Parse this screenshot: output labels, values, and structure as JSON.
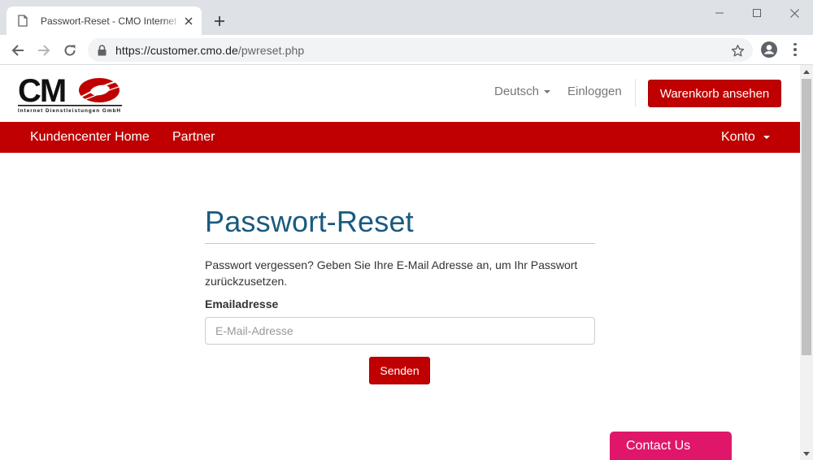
{
  "browser": {
    "tab_title": "Passwort-Reset - CMO Internet Dienstleistungen GmbH",
    "url_host": "https://customer.cmo.de",
    "url_path": "/pwreset.php"
  },
  "site": {
    "logo_letters": "CMO",
    "logo_subtitle": "Internet Dienstleistungen GmbH",
    "brand_color": "#c00000",
    "language_label": "Deutsch",
    "login_label": "Einloggen",
    "cart_button": "Warenkorb ansehen"
  },
  "nav": {
    "items": [
      {
        "label": "Kundencenter Home"
      },
      {
        "label": "Partner"
      }
    ],
    "account_label": "Konto"
  },
  "main": {
    "title": "Passwort-Reset",
    "title_color": "#1a5a80",
    "intro": "Passwort vergessen? Geben Sie Ihre E-Mail Adresse an, um Ihr Passwort zurückzusetzen.",
    "email_label": "Emailadresse",
    "email_placeholder": "E-Mail-Adresse",
    "email_value": "",
    "submit_label": "Senden"
  },
  "contact": {
    "label": "Contact Us",
    "color": "#e0166a"
  }
}
